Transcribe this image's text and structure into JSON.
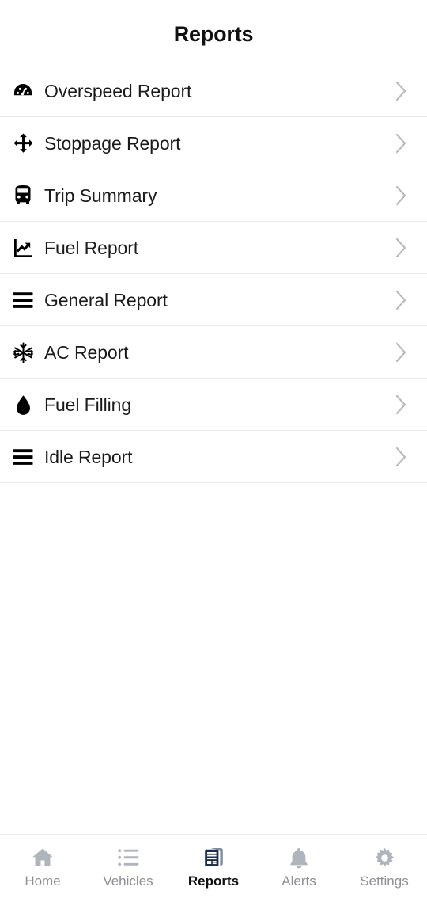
{
  "header": {
    "title": "Reports"
  },
  "colors": {
    "background": "#ffffff",
    "text_primary": "#1a1a1a",
    "text_title": "#111111",
    "icon_dark": "#000000",
    "chevron": "#b9b9bd",
    "separator": "#e9e9ec",
    "nav_inactive": "#8e8e93",
    "nav_icon_inactive": "#b0b4bd",
    "nav_active": "#111111",
    "nav_icon_active": "#1b2e4b"
  },
  "report_list": {
    "items": [
      {
        "label": "Overspeed Report",
        "icon": "tachometer-icon",
        "chevron": "chevron-right-icon"
      },
      {
        "label": "Stoppage Report",
        "icon": "arrows-move-icon",
        "chevron": "chevron-right-icon"
      },
      {
        "label": "Trip Summary",
        "icon": "bus-icon",
        "chevron": "chevron-right-icon"
      },
      {
        "label": "Fuel Report",
        "icon": "chart-line-up-icon",
        "chevron": "chevron-right-icon"
      },
      {
        "label": "General Report",
        "icon": "bars-icon",
        "chevron": "chevron-right-icon"
      },
      {
        "label": "AC Report",
        "icon": "snowflake-icon",
        "chevron": "chevron-right-icon"
      },
      {
        "label": "Fuel Filling",
        "icon": "droplet-icon",
        "chevron": "chevron-right-icon"
      },
      {
        "label": "Idle Report",
        "icon": "bars-icon",
        "chevron": "chevron-right-icon"
      }
    ]
  },
  "bottom_nav": {
    "items": [
      {
        "label": "Home",
        "icon": "home-icon",
        "active": false
      },
      {
        "label": "Vehicles",
        "icon": "list-ul-icon",
        "active": false
      },
      {
        "label": "Reports",
        "icon": "document-icon",
        "active": true
      },
      {
        "label": "Alerts",
        "icon": "bell-icon",
        "active": false
      },
      {
        "label": "Settings",
        "icon": "gear-icon",
        "active": false
      }
    ]
  }
}
